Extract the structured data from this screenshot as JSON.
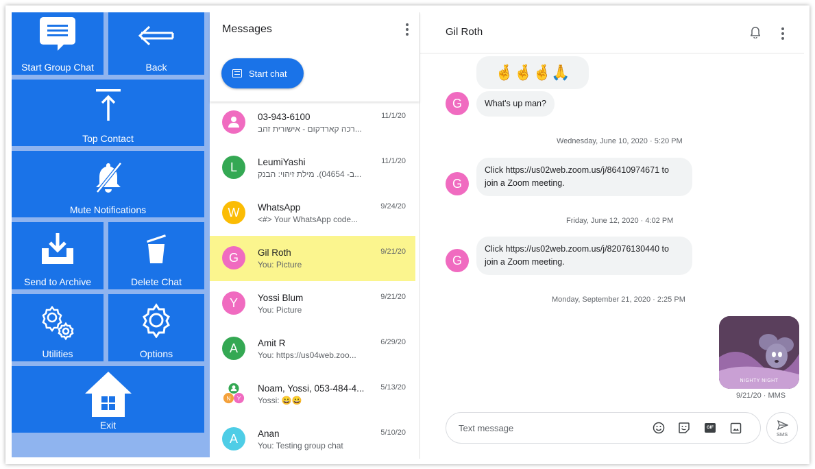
{
  "tiles": {
    "start_group_chat": "Start Group Chat",
    "back": "Back",
    "top_contact": "Top Contact",
    "mute_notifications": "Mute Notifications",
    "send_to_archive": "Send to Archive",
    "delete_chat": "Delete Chat",
    "utilities": "Utilities",
    "options": "Options",
    "exit": "Exit"
  },
  "messages_panel": {
    "title": "Messages",
    "start_chat_label": "Start chat",
    "conversations": [
      {
        "name": "03-943-6100",
        "snippet": "...רכה קארדקום - אישורית זהב",
        "date": "11/1/20",
        "avatar": "",
        "avatar_color": "#f06bc0",
        "avatar_icon": "person-icon"
      },
      {
        "name": "LeumiYashi",
        "snippet": "...ב- 04654). מילת זיהוי: הבנק",
        "date": "11/1/20",
        "avatar": "L",
        "avatar_color": "#34a853"
      },
      {
        "name": "WhatsApp",
        "snippet": "<#> Your WhatsApp code...",
        "date": "9/24/20",
        "avatar": "W",
        "avatar_color": "#fbbc04"
      },
      {
        "name": "Gil Roth",
        "snippet": "You: Picture",
        "date": "9/21/20",
        "avatar": "G",
        "avatar_color": "#f06bc0",
        "active": true
      },
      {
        "name": "Yossi Blum",
        "snippet": "You: Picture",
        "date": "9/21/20",
        "avatar": "Y",
        "avatar_color": "#f06bc0"
      },
      {
        "name": "Amit R",
        "snippet": "You: https://us04web.zoo...",
        "date": "6/29/20",
        "avatar": "A",
        "avatar_color": "#34a853"
      },
      {
        "name": "Noam, Yossi, 053-484-4...",
        "snippet": "Yossi: 😀😀",
        "date": "5/13/20",
        "avatar": "group",
        "avatar_color": "#34a853"
      },
      {
        "name": "Anan",
        "snippet": "You: Testing group chat",
        "date": "5/10/20",
        "avatar": "A",
        "avatar_color": "#4ecde6"
      }
    ]
  },
  "chat": {
    "contact_name": "Gil Roth",
    "emoji_message": "🤞🤞🤞🙏",
    "messages": [
      {
        "text": "What's up man?"
      },
      {
        "datestamp": "Wednesday, June 10, 2020 · 5:20 PM"
      },
      {
        "text": "Click https://us02web.zoom.us/j/86410974671 to join a Zoom meeting."
      },
      {
        "datestamp": "Friday, June 12, 2020 · 4:02 PM"
      },
      {
        "text": "Click https://us02web.zoom.us/j/82076130440 to join a Zoom meeting."
      },
      {
        "datestamp": "Monday, September 21, 2020 · 2:25 PM"
      }
    ],
    "avatar_letter": "G",
    "picture_caption": "NIGHTY NIGHT",
    "picture_meta": "9/21/20 · MMS",
    "composer_placeholder": "Text message",
    "send_label": "SMS",
    "gif_label": "GIF"
  }
}
